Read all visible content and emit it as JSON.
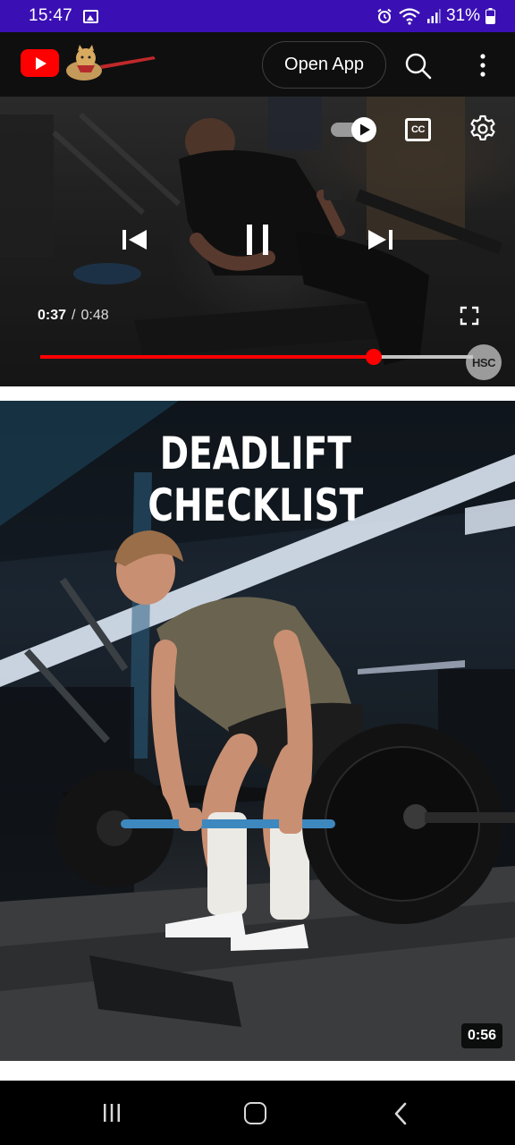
{
  "status_bar": {
    "time": "15:47",
    "battery": "31%"
  },
  "header": {
    "open_app_label": "Open App",
    "brand_color": "#ff0000"
  },
  "player": {
    "current_time": "0:37",
    "separator": "/",
    "duration": "0:48",
    "progress_fraction": 0.771,
    "cc_label": "CC",
    "watermark": "HSC",
    "autoplay_on": true
  },
  "thumbnail": {
    "title": "DEADLIFT CHECKLIST",
    "duration": "0:56"
  },
  "icons": {
    "status_bar": [
      "gallery-icon",
      "alarm-icon",
      "wifi-icon",
      "signal-icon",
      "battery-icon"
    ],
    "header": [
      "youtube-logo-icon",
      "search-icon",
      "more-vert-icon"
    ],
    "player": [
      "autoplay-toggle-icon",
      "cc-icon",
      "settings-gear-icon",
      "previous-icon",
      "pause-icon",
      "next-icon",
      "fullscreen-icon"
    ],
    "nav": [
      "recents-icon",
      "home-icon",
      "back-icon"
    ]
  }
}
